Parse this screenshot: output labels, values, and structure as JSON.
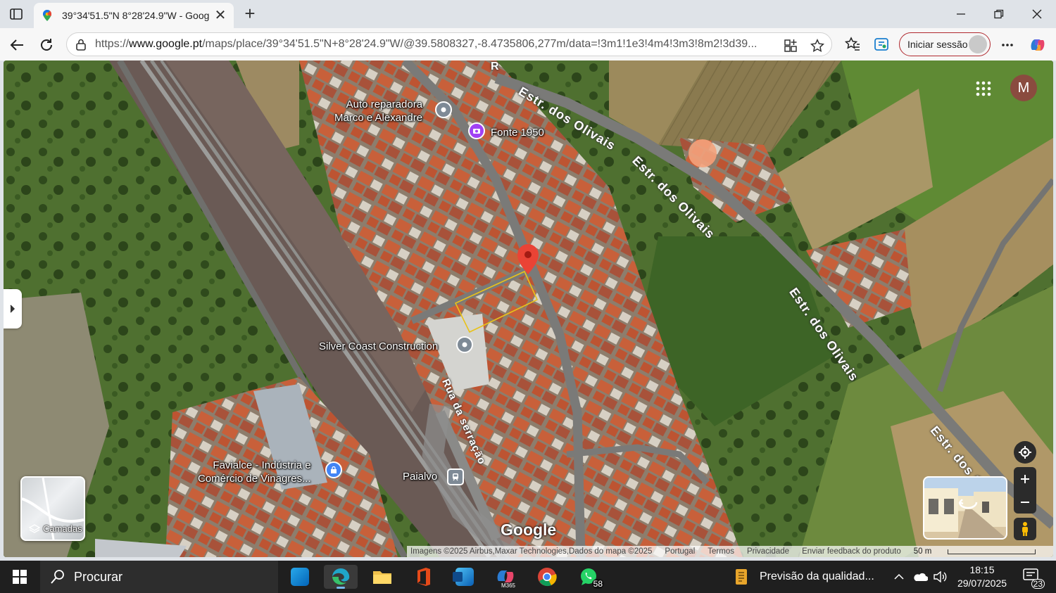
{
  "tab": {
    "title": "39°34'51.5\"N 8°28'24.9\"W - Goog",
    "favicon": "google-maps-pin-icon"
  },
  "address": {
    "url_prefix": "https://",
    "url_host": "www.google.pt",
    "url_path": "/maps/place/39°34'51.5\"N+8°28'24.9\"W/@39.5808327,-8.4735806,277m/data=!3m1!1e3!4m4!3m3!8m2!3d39...",
    "signin_label": "Iniciar sessão"
  },
  "map": {
    "places": [
      {
        "label_lines": [
          "Auto reparadora",
          "Marco e Alexandre"
        ],
        "icon": "location-pin-icon"
      },
      {
        "label": "Fonte 1950",
        "icon": "camera-pin-icon"
      },
      {
        "label": "Silver Coast Construction",
        "icon": "location-pin-icon"
      },
      {
        "label_lines": [
          "Favialce - Indústria e",
          "Comércio de Vinagres..."
        ],
        "icon": "shopping-pin-icon"
      },
      {
        "label": "Paialvo",
        "icon": "train-station-icon"
      }
    ],
    "roads": [
      "Estr. dos Olivais",
      "Estr. dos Olivais",
      "Estr. dos Olivais",
      "Estr. dos Oli",
      "Rua da serração"
    ],
    "road_fragment": "R",
    "layers_label": "Camadas",
    "account_initial": "M",
    "logo_text": "Google",
    "footer": {
      "attribution": "Imagens ©2025 Airbus,Maxar Technologies,Dados do mapa ©2025",
      "country": "Portugal",
      "terms": "Termos",
      "privacy": "Privacidade",
      "feedback": "Enviar feedback do produto",
      "scale": "50 m"
    },
    "colors": {
      "pin": "#ea4335",
      "parcel_outline": "#e8c21a",
      "camera_pin": "#a142f4",
      "poi_pin": "#7e8a96",
      "shop_pin": "#4285f4"
    }
  },
  "taskbar": {
    "search_label": "Procurar",
    "news_text": "Previsão da qualidad...",
    "time": "18:15",
    "date": "29/07/2025",
    "whatsapp_badge": "58",
    "notifications_badge": "23",
    "m365_label": "M365",
    "apps": [
      "outlook-icon",
      "edge-icon",
      "file-explorer-icon",
      "office-icon",
      "outlook-new-icon",
      "microsoft-365-icon",
      "chrome-icon",
      "whatsapp-icon"
    ]
  }
}
